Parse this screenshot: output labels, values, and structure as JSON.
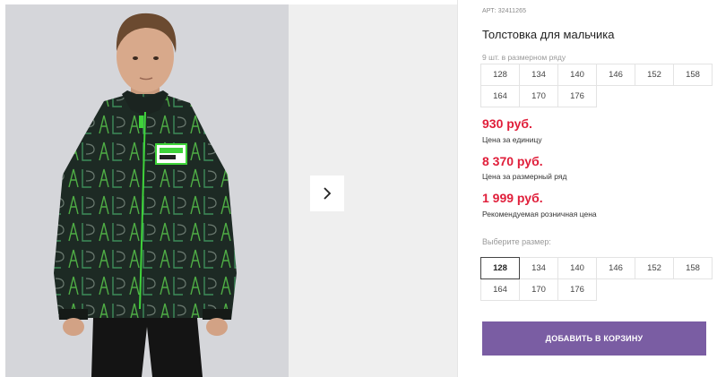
{
  "product": {
    "article": "АРТ: 32411265",
    "title": "Толстовка для мальчика",
    "pack_info": "9 шт. в размерном ряду",
    "pack_sizes": [
      "128",
      "134",
      "140",
      "146",
      "152",
      "158",
      "164",
      "170",
      "176"
    ]
  },
  "prices": {
    "unit_price": "930 руб.",
    "unit_label": "Цена за единицу",
    "pack_price": "8 370 руб.",
    "pack_label": "Цена за размерный ряд",
    "retail_price": "1 999 руб.",
    "retail_label": "Рекомендуемая розничная цена"
  },
  "size_selector": {
    "label": "Выберите размер:",
    "options": [
      "128",
      "134",
      "140",
      "146",
      "152",
      "158",
      "164",
      "170",
      "176"
    ],
    "selected": "128"
  },
  "actions": {
    "add_to_cart": "ДОБАВИТЬ В КОРЗИНУ"
  },
  "gallery": {
    "next_icon": "chevron-right-icon"
  },
  "colors": {
    "price_red": "#e01e3a",
    "button_purple": "#7a5da3",
    "jacket_green": "#3fd33a"
  }
}
